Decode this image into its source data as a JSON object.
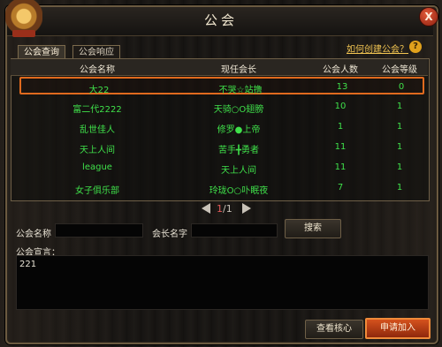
{
  "window": {
    "title": "公会",
    "close_label": "X"
  },
  "tabs": [
    {
      "label": "公会查询",
      "active": true
    },
    {
      "label": "公会响应",
      "active": false
    }
  ],
  "help": {
    "link_label": "如何创建公会？",
    "icon_label": "?"
  },
  "table": {
    "columns": [
      "公会名称",
      "现任会长",
      "公会人数",
      "公会等级"
    ],
    "rows": [
      {
        "name": "大22",
        "leader": "不哭☆站撸",
        "members": "13",
        "level": "0"
      },
      {
        "name": "富二代2222",
        "leader": "天骑○O翅膀",
        "members": "10",
        "level": "1"
      },
      {
        "name": "乱世佳人",
        "leader": "修罗●上帝",
        "members": "1",
        "level": "1"
      },
      {
        "name": "天上人间",
        "leader": "苦手╋勇者",
        "members": "11",
        "level": "1"
      },
      {
        "name": "league",
        "leader": "天上人间",
        "members": "11",
        "level": "1"
      },
      {
        "name": "女子俱乐部",
        "leader": "玲珑O○卟眠夜",
        "members": "7",
        "level": "1"
      }
    ],
    "selected_index": 0
  },
  "pagination": {
    "current": "1",
    "total": "/1"
  },
  "search": {
    "guild_name_label": "公会名称",
    "leader_name_label": "会长名字",
    "guild_name_value": "",
    "leader_name_value": "",
    "search_button": "搜索"
  },
  "declaration": {
    "label": "公会宣言：",
    "text": "221"
  },
  "footer": {
    "view_core_button": "查看核心",
    "apply_button": "申请加入"
  },
  "colors": {
    "accent": "#e06a1e",
    "green_text": "#3fe04a",
    "gold_text": "#f2c552"
  }
}
